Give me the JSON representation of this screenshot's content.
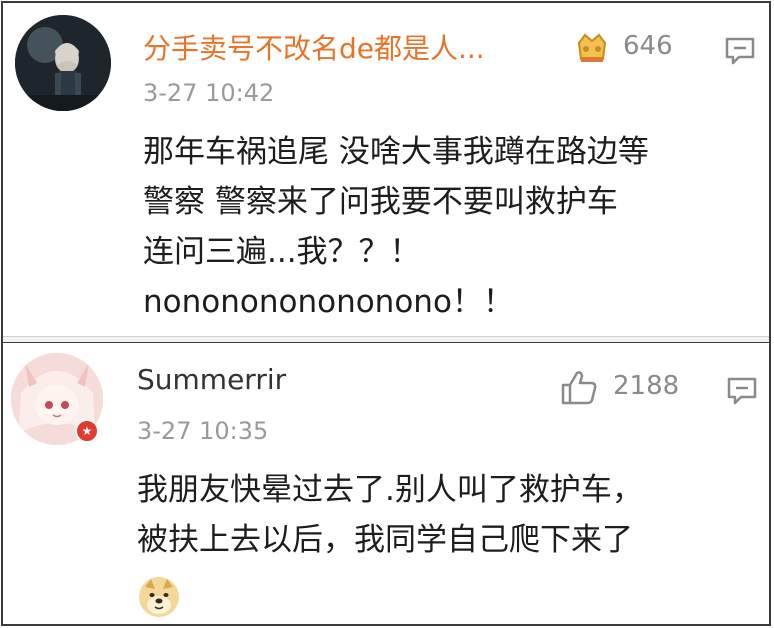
{
  "comments": [
    {
      "username": "分手卖号不改名de都是人...",
      "count": "646",
      "timestamp": "3-27 10:42",
      "lines": [
        "那年车祸追尾 没啥大事我蹲在路边等",
        "警察 警察来了问我要不要叫救护车",
        "连问三遍...我？？！",
        "nononononononono！！"
      ],
      "badge_icon": "level-badge-icon",
      "reply_icon": "comment-reply-icon"
    },
    {
      "username": "Summerrir",
      "count": "2188",
      "timestamp": "3-27 10:35",
      "lines": [
        "我朋友快晕过去了.别人叫了救护车，",
        "被扶上去以后，我同学自己爬下来了"
      ],
      "like_icon": "thumbs-up-icon",
      "reply_icon": "comment-reply-icon",
      "emoji": "doge-emoji"
    }
  ],
  "colors": {
    "username_highlight": "#e8742a",
    "meta_gray": "#9a9a9a",
    "vip_badge": "#e23b2e"
  }
}
